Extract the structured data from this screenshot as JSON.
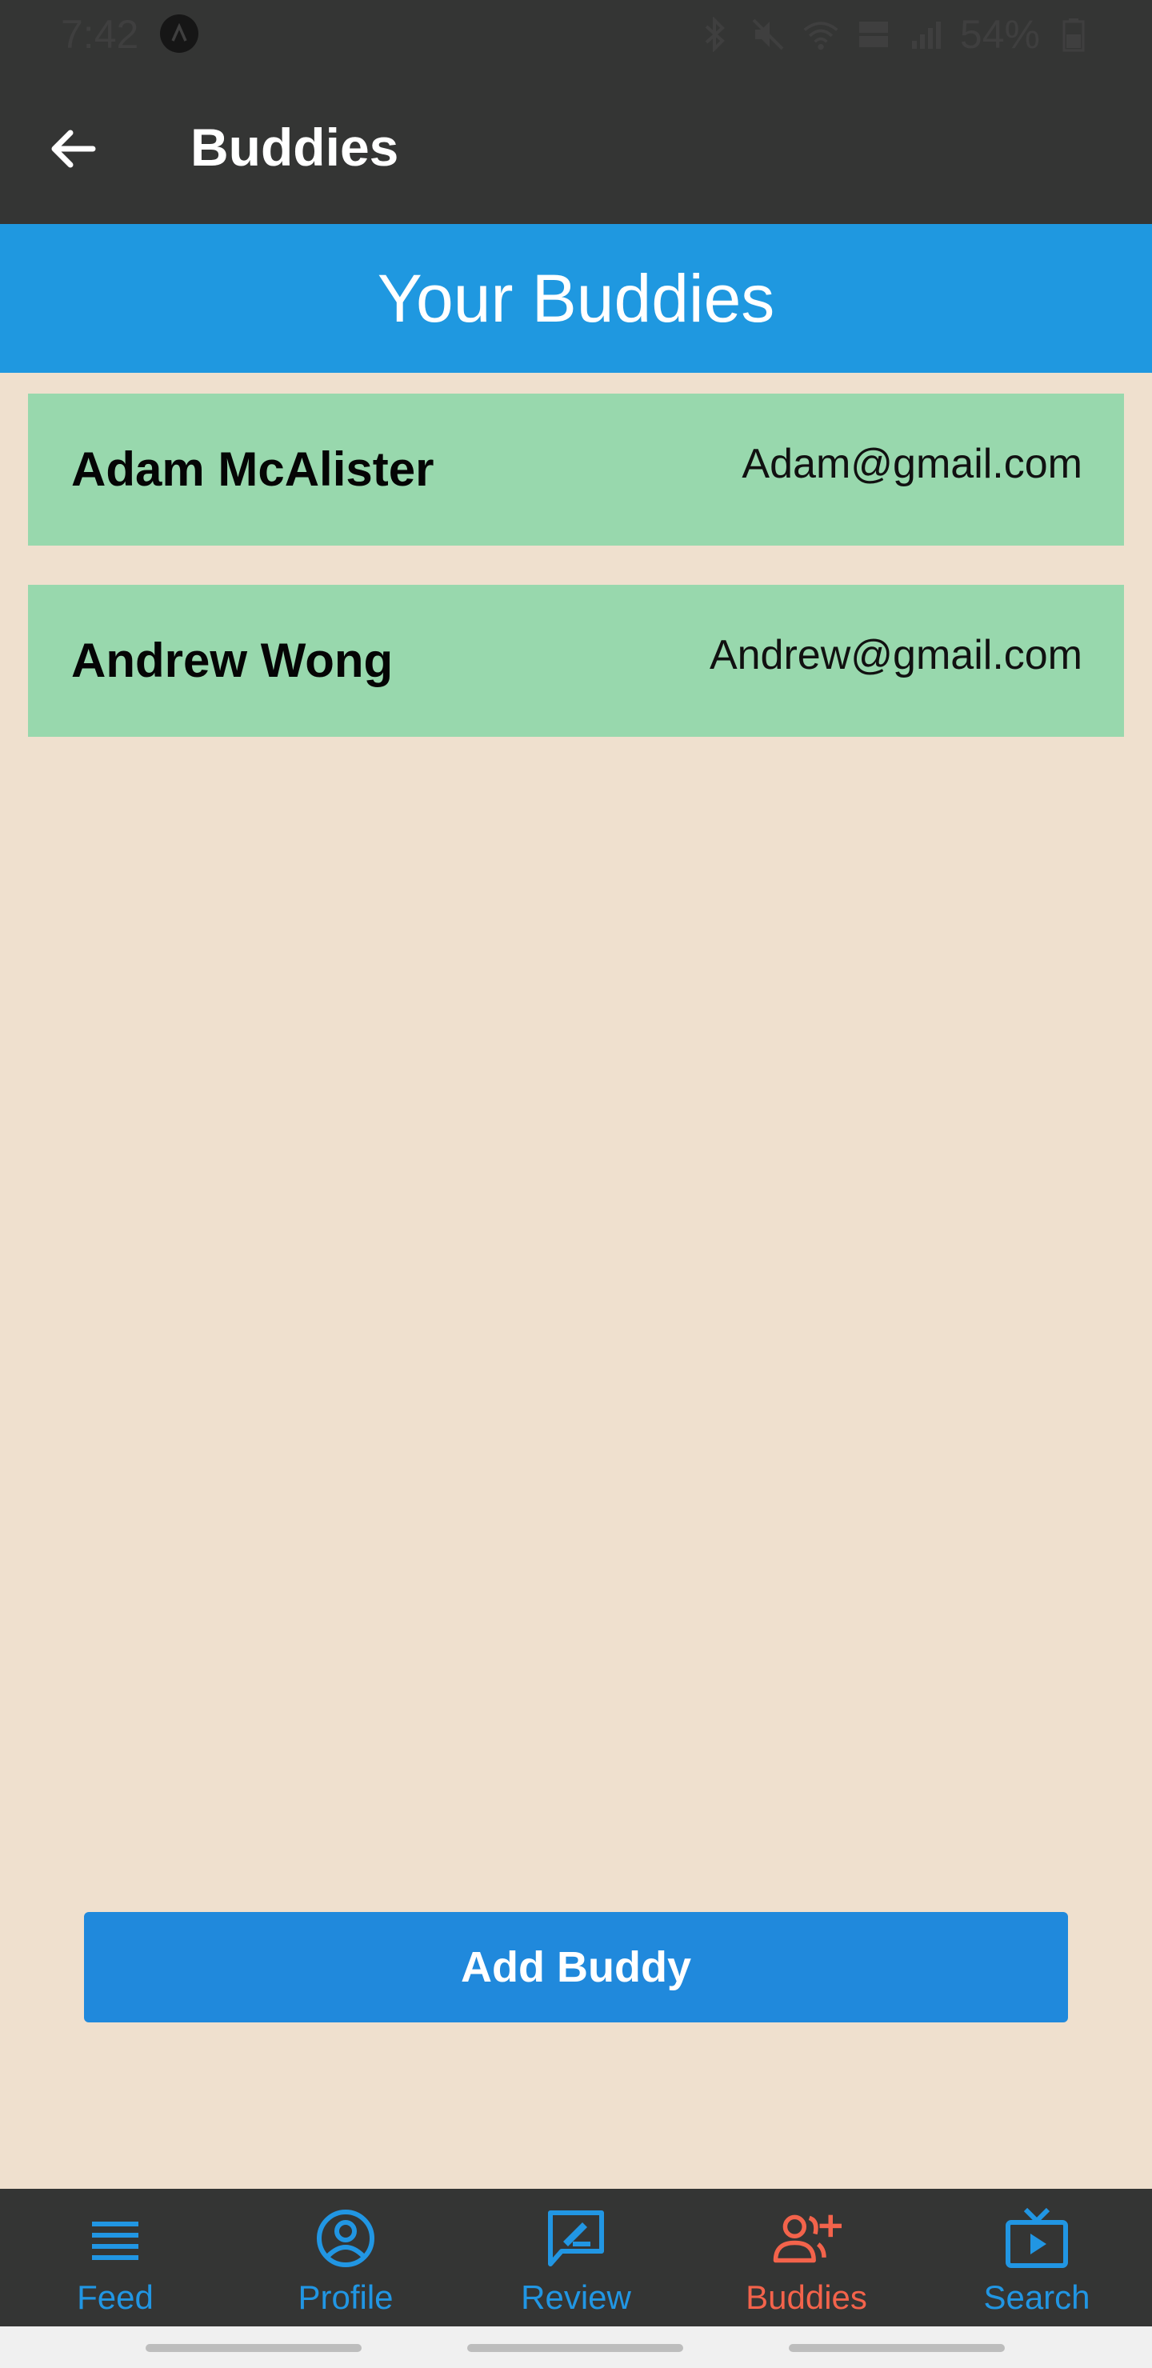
{
  "status_bar": {
    "time": "7:42",
    "battery": "54%"
  },
  "header": {
    "title": "Buddies"
  },
  "banner": {
    "title": "Your Buddies"
  },
  "buddies": [
    {
      "name": "Adam McAlister",
      "email": "Adam@gmail.com"
    },
    {
      "name": "Andrew Wong",
      "email": "Andrew@gmail.com"
    }
  ],
  "actions": {
    "add_buddy_label": "Add Buddy"
  },
  "nav": {
    "items": [
      {
        "label": "Feed",
        "icon": "feed-icon"
      },
      {
        "label": "Profile",
        "icon": "profile-icon"
      },
      {
        "label": "Review",
        "icon": "review-icon"
      },
      {
        "label": "Buddies",
        "icon": "add-buddy-icon",
        "active": true
      },
      {
        "label": "Search",
        "icon": "tv-search-icon"
      }
    ]
  },
  "colors": {
    "header_bg": "#343534",
    "banner_bg": "#1f98e0",
    "page_bg": "#efe0ce",
    "row_bg": "#98d8ad",
    "button_bg": "#2089dc",
    "nav_inactive": "#2196e3",
    "nav_active": "#f3634b"
  }
}
